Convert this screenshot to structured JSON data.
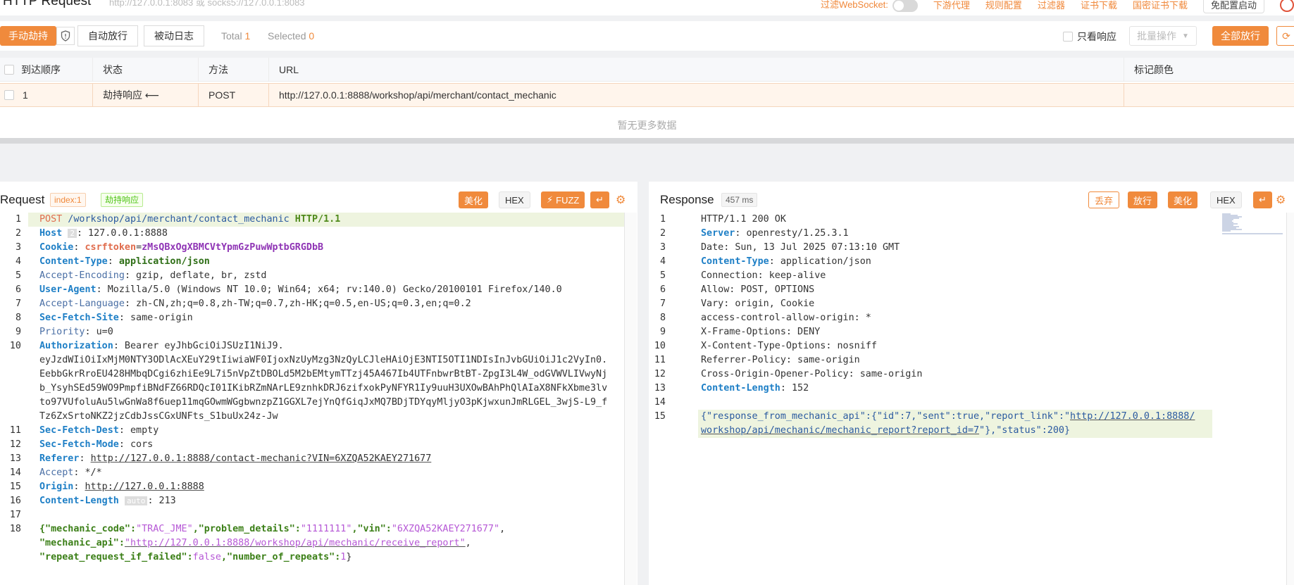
{
  "header": {
    "title": "HTTP Request",
    "proxy_hint": "http://127.0.0.1:8083 或 socks5://127.0.0.1:8083",
    "filter_ws_label": "过滤WebSocket:",
    "links": [
      "下游代理",
      "规则配置",
      "过滤器",
      "证书下载",
      "国密证书下载"
    ],
    "restart_label": "免配置启动"
  },
  "toolbar": {
    "manual_hijack": "手动劫持",
    "auto_release": "自动放行",
    "passive_log": "被动日志",
    "total_label": "Total",
    "total_value": "1",
    "selected_label": "Selected",
    "selected_value": "0",
    "only_response": "只看响应",
    "batch_ops": "批量操作",
    "release_all": "全部放行"
  },
  "table": {
    "columns": [
      "到达顺序",
      "状态",
      "方法",
      "URL",
      "标记颜色"
    ],
    "rows": [
      {
        "order": "1",
        "status": "劫持响应",
        "method": "POST",
        "url": "http://127.0.0.1:8888/workshop/api/merchant/contact_mechanic",
        "color": ""
      }
    ],
    "empty_text": "暂无更多数据"
  },
  "request": {
    "title": "Request",
    "index_tag": "index:1",
    "status_tag": "劫持响应",
    "beautify": "美化",
    "hex": "HEX",
    "fuzz": "FUZZ",
    "lines": {
      "l1_method": "POST",
      "l1_path": " /workshop/api/merchant/contact_mechanic ",
      "l1_proto": "HTTP/1.1",
      "l2_key": "Host",
      "l2_badge": "2",
      "l2_val": ": 127.0.0.1:8888",
      "l3_key": "Cookie",
      "l3_ck": "csrftoken",
      "l3_cv": "zMsQBxOgXBMCVtYpmGzPuwWptbGRGDbB",
      "l4_key": "Content-Type",
      "l4_val": "application/json",
      "l5_key": "Accept-Encoding",
      "l5_val": ": gzip, deflate, br, zstd",
      "l6_key": "User-Agent",
      "l6_val": ": Mozilla/5.0 (Windows NT 10.0; Win64; x64; rv:140.0) Gecko/20100101 Firefox/140.0",
      "l7_key": "Accept-Language",
      "l7_val": ": zh-CN,zh;q=0.8,zh-TW;q=0.7,zh-HK;q=0.5,en-US;q=0.3,en;q=0.2",
      "l8_key": "Sec-Fetch-Site",
      "l8_val": ": same-origin",
      "l9_key": "Priority",
      "l9_val": ": u=0",
      "l10_key": "Authorization",
      "l10_val": ": Bearer eyJhbGciOiJSUzI1NiJ9.",
      "l10_w1": "eyJzdWIiOiIxMjM0NTY3ODlAcXEuY29tIiwiaWF0IjoxNzUyMzg3NzQyLCJleHAiOjE3NTI5OTI1NDIsInJvbGUiOiJ1c2VyIn0.",
      "l10_w2": "EebbGkrRroEU428HMbqDCgi6zhiEe9L7i5nVpZtDBOLd5M2bEMtymTTzj45A467Ib4UTFnbwrBtBT-ZpgI3L4W_odGVWVLIVwyNj",
      "l10_w3": "b_YsyhSEd59WO9PmpfiBNdFZ66RDQcI01IKibRZmNArLE9znhkDRJ6zifxokPyNFYR1Iy9uuH3UXOwBAhPhQlAIaX8NFkXbme3lv",
      "l10_w4": "to97VUfoluAu5lwGnWa8f6uep11mqGOwmWGgbwnzpZ1GGXL7ejYnQfGiqJxMQ7BDjTDYqyMljyO3pKjwxunJmRLGEL_3wjS-L9_f",
      "l10_w5": "Tz6ZxSrtoNKZ2jzCdbJssCGxUNFts_S1buUx24z-Jw",
      "l11_key": "Sec-Fetch-Dest",
      "l11_val": ": empty",
      "l12_key": "Sec-Fetch-Mode",
      "l12_val": ": cors",
      "l13_key": "Referer",
      "l13_val": "http://127.0.0.1:8888/contact-mechanic?VIN=6XZQA52KAEY271677",
      "l14_key": "Accept",
      "l14_val": ": */*",
      "l15_key": "Origin",
      "l15_val": "http://127.0.0.1:8888",
      "l16_key": "Content-Length",
      "l16_badge": "auto",
      "l16_val": ": 213",
      "l18_a": "{\"mechanic_code\":",
      "l18_b": "\"TRAC_JME\"",
      "l18_c": ",\"problem_details\":",
      "l18_d": "\"1111111\"",
      "l18_e": ",\"vin\":",
      "l18_f": "\"6XZQA52KAEY271677\"",
      "l18_g": ",",
      "l18w1_a": "\"mechanic_api\":",
      "l18w1_b": "\"http://127.0.0.1:8888/workshop/api/mechanic/receive_report\"",
      "l18w1_c": ",",
      "l18w2_a": "\"repeat_request_if_failed\":",
      "l18w2_b": "false",
      "l18w2_c": ",\"number_of_repeats\":",
      "l18w2_d": "1",
      "l18w2_e": "}"
    }
  },
  "response": {
    "title": "Response",
    "time_tag": "457 ms",
    "discard": "丢弃",
    "release": "放行",
    "beautify": "美化",
    "hex": "HEX",
    "lines": {
      "r1": "HTTP/1.1 200 OK",
      "r2_key": "Server",
      "r2_val": ": openresty/1.25.3.1",
      "r3": "Date: Sun, 13 Jul 2025 07:13:10 GMT",
      "r4_key": "Content-Type",
      "r4_val": ": application/json",
      "r5": "Connection: keep-alive",
      "r6": "Allow: POST, OPTIONS",
      "r7": "Vary: origin, Cookie",
      "r8": "access-control-allow-origin: *",
      "r9": "X-Frame-Options: DENY",
      "r10": "X-Content-Type-Options: nosniff",
      "r11": "Referrer-Policy: same-origin",
      "r12": "Cross-Origin-Opener-Policy: same-origin",
      "r13_key": "Content-Length",
      "r13_val": ": 152",
      "r15_a": "{\"response_from_mechanic_api\":{\"id\":7,\"sent\":true,\"report_link\":\"",
      "r15_b": "http://127.0.0.1:8888/",
      "r15w_a": "workshop/api/mechanic/mechanic_report?report_id=7",
      "r15w_b": "\"},\"status\":200}"
    }
  },
  "colors": {
    "accent": "#f08a3c",
    "key_blue": "#1e7fc6",
    "string_purple": "#b658d6"
  }
}
